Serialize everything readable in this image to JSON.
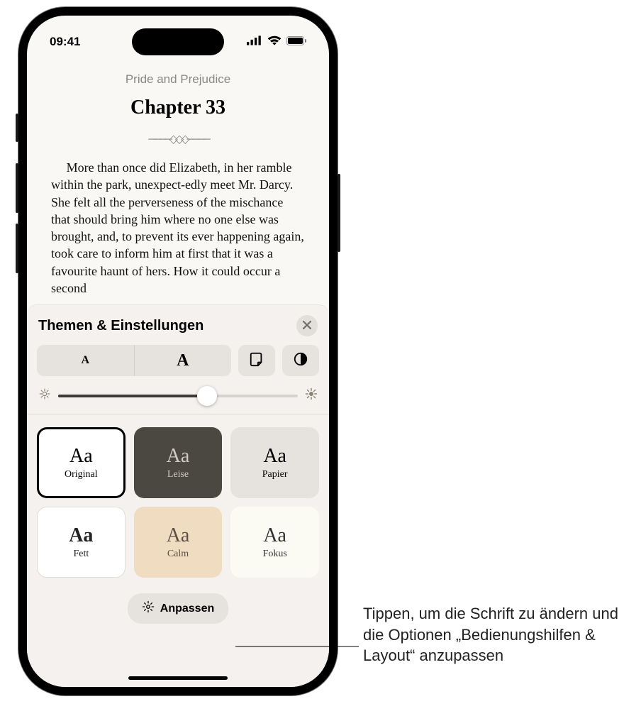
{
  "status": {
    "time": "09:41"
  },
  "book": {
    "title": "Pride and Prejudice",
    "chapter": "Chapter 33",
    "body": "More than once did Elizabeth, in her ramble within the park, unexpect-edly meet Mr. Darcy. She felt all the perverseness of the mischance that should bring him where no one else was brought, and, to prevent its ever happening again, took care to inform him at first that it was a favourite haunt of hers. How it could occur a second"
  },
  "sheet": {
    "title": "Themen & Einstellungen",
    "themes": [
      {
        "label": "Original"
      },
      {
        "label": "Leise"
      },
      {
        "label": "Papier"
      },
      {
        "label": "Fett"
      },
      {
        "label": "Calm"
      },
      {
        "label": "Fokus"
      }
    ],
    "customize": "Anpassen"
  },
  "callout": "Tippen, um die Schrift zu ändern und die Optionen „Bedienungshilfen & Layout“ anzupassen",
  "glyph": {
    "aa": "Aa",
    "small_a": "A",
    "big_a": "A"
  }
}
